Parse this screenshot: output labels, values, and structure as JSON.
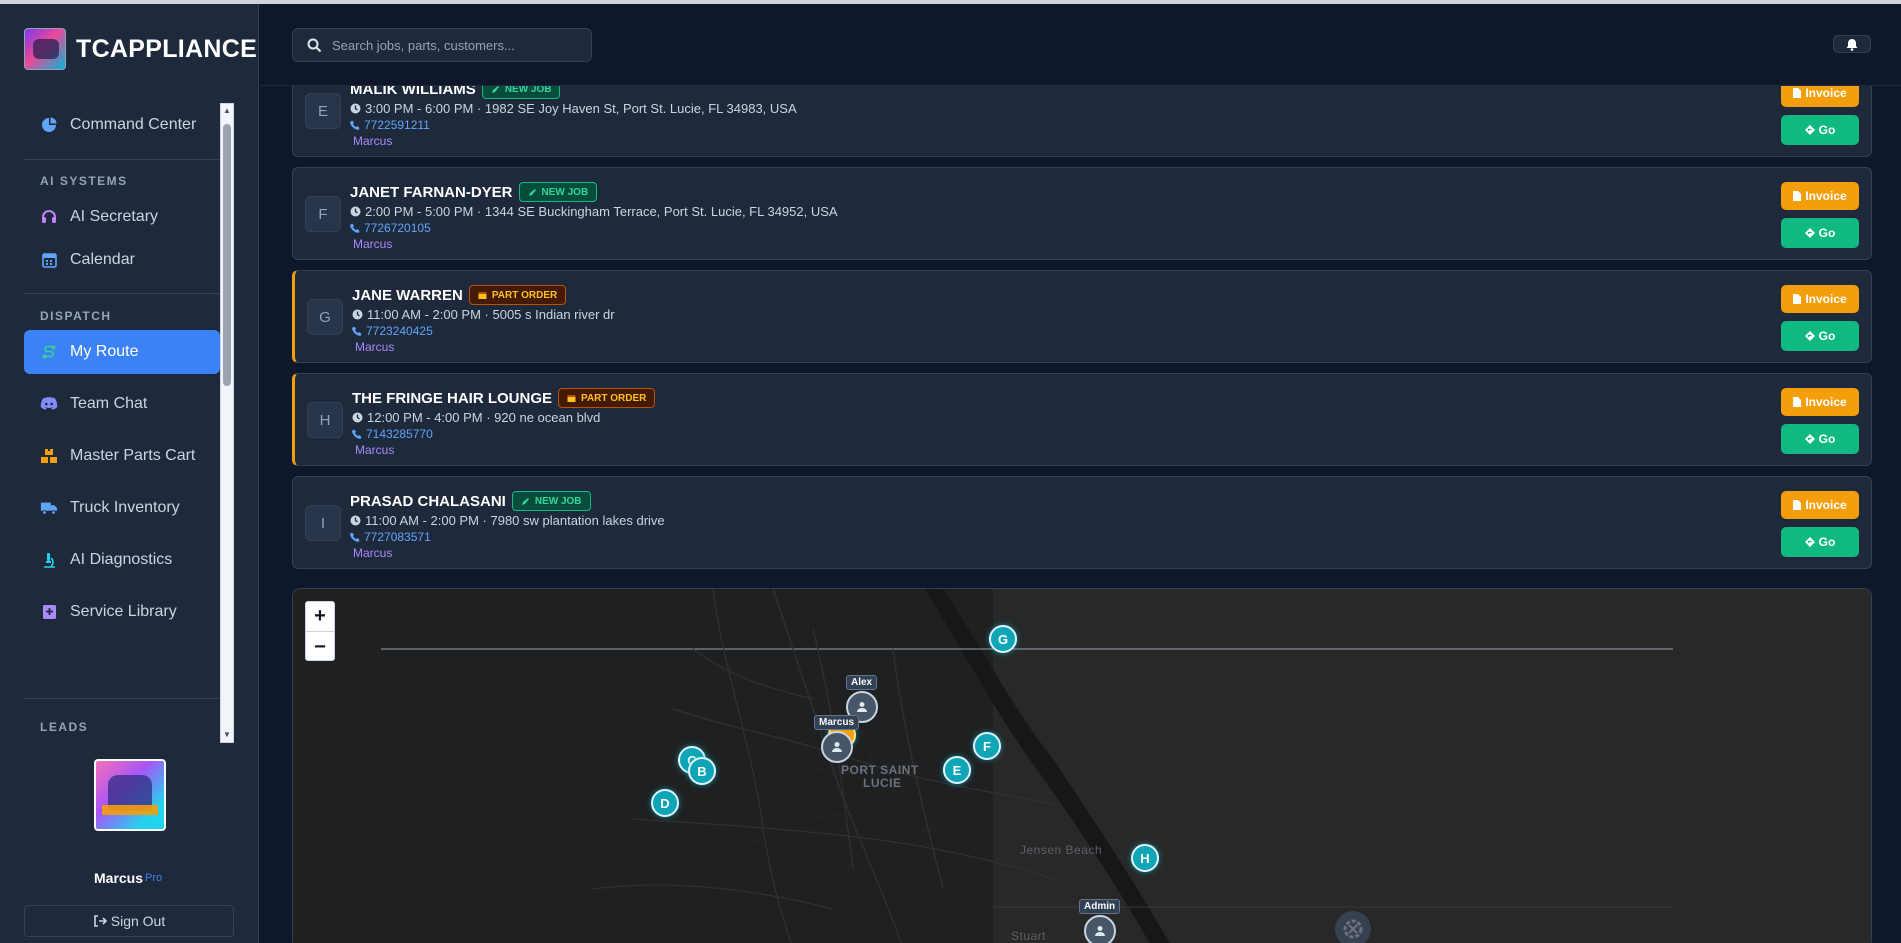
{
  "app": {
    "brand": "TCAPPLIANCE"
  },
  "sidebar": {
    "items": [
      {
        "label": "Command Center",
        "icon": "pie-chart-icon",
        "color": "#60a5fa"
      },
      {
        "label": "AI Secretary",
        "icon": "headset-icon",
        "color": "#c084fc"
      },
      {
        "label": "Calendar",
        "icon": "calendar-icon",
        "color": "#60a5fa"
      },
      {
        "label": "My Route",
        "icon": "route-icon",
        "color": "#34d399",
        "active": true
      },
      {
        "label": "Team Chat",
        "icon": "discord-icon",
        "color": "#818cf8"
      },
      {
        "label": "Master Parts Cart",
        "icon": "boxes-icon",
        "color": "#f59e0b"
      },
      {
        "label": "Truck Inventory",
        "icon": "truck-icon",
        "color": "#60a5fa"
      },
      {
        "label": "AI Diagnostics",
        "icon": "microscope-icon",
        "color": "#22d3ee"
      },
      {
        "label": "Service Library",
        "icon": "book-icon",
        "color": "#a78bfa"
      }
    ],
    "sections": {
      "ai": "AI SYSTEMS",
      "dispatch": "DISPATCH",
      "leads": "LEADS"
    },
    "user": {
      "name": "Marcus",
      "badge": "Pro"
    },
    "signout_label": "Sign Out"
  },
  "header": {
    "search_placeholder": "Search jobs, parts, customers..."
  },
  "jobs": [
    {
      "letter": "E",
      "name": "MALIK WILLIAMS",
      "tag": "NEW JOB",
      "tag_type": "new",
      "time": "3:00 PM - 6:00 PM · 1982 SE Joy Haven St, Port St. Lucie, FL 34983, USA",
      "phone": "7722591211",
      "tech": "Marcus"
    },
    {
      "letter": "F",
      "name": "JANET FARNAN-DYER",
      "tag": "NEW JOB",
      "tag_type": "new",
      "time": "2:00 PM - 5:00 PM · 1344 SE Buckingham Terrace, Port St. Lucie, FL 34952, USA",
      "phone": "7726720105",
      "tech": "Marcus"
    },
    {
      "letter": "G",
      "name": "JANE WARREN",
      "tag": "PART ORDER",
      "tag_type": "part",
      "time": "11:00 AM - 2:00 PM · 5005 s Indian river dr",
      "phone": "7723240425",
      "tech": "Marcus"
    },
    {
      "letter": "H",
      "name": "THE FRINGE HAIR LOUNGE",
      "tag": "PART ORDER",
      "tag_type": "part",
      "time": "12:00 PM - 4:00 PM · 920 ne ocean blvd",
      "phone": "7143285770",
      "tech": "Marcus"
    },
    {
      "letter": "I",
      "name": "PRASAD CHALASANI",
      "tag": "NEW JOB",
      "tag_type": "new",
      "time": "11:00 AM - 2:00 PM · 7980 sw plantation lakes drive",
      "phone": "7727083571",
      "tech": "Marcus"
    }
  ],
  "buttons": {
    "invoice": "Invoice",
    "go": "Go"
  },
  "map": {
    "zoom_in": "+",
    "zoom_out": "−",
    "pins": [
      "G",
      "F",
      "E",
      "C",
      "B",
      "D",
      "H"
    ],
    "techs": [
      "Alex",
      "Marcus",
      "Admin"
    ],
    "places": [
      "PORT SAINT",
      "LUCIE",
      "Jensen Beach",
      "Stuart"
    ]
  }
}
